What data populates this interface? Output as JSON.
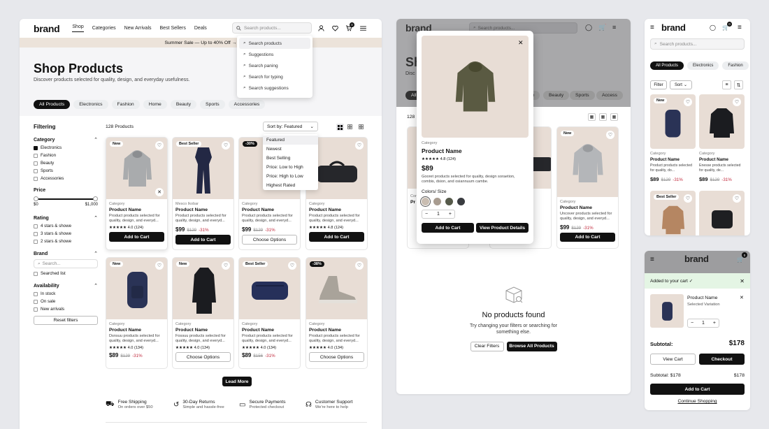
{
  "brand": "brand",
  "nav": [
    "Shop",
    "Categories",
    "New Arrivals",
    "Best Sellers",
    "Deals"
  ],
  "search_placeholder": "Search products...",
  "cart_count": "0",
  "banner": "Summer Sale — Up to 40% Off →",
  "suggestions": [
    "Search products",
    "Suggestions",
    "Search paning",
    "Search for typing",
    "Search suggestions"
  ],
  "hero": {
    "title": "Shop Products",
    "subtitle": "Discover products selected for quality, design, and everyday usefulness."
  },
  "categories": [
    "All Products",
    "Electronics",
    "Fashion",
    "Home",
    "Beauty",
    "Sports",
    "Accessories"
  ],
  "filter": {
    "title": "Filtering",
    "category_label": "Category",
    "category_options": [
      "Electronics",
      "Fashion",
      "Beauty",
      "Sports",
      "Accessories"
    ],
    "price_label": "Price",
    "price_min": "$0",
    "price_max": "$1,000",
    "rating_label": "Rating",
    "rating_options": [
      "4 stars & showe",
      "3 stars & showe",
      "2 stars & showe"
    ],
    "brand_label": "Brand",
    "brand_search": "Search...",
    "brand_option": "Searched list",
    "availability_label": "Availability",
    "availability_options": [
      "In stock",
      "On sale",
      "New arrivals"
    ],
    "reset": "Reset filters"
  },
  "count": "128 Products",
  "sort": {
    "label": "Sort by: Featured",
    "options": [
      "Featured",
      "Newest",
      "Best Selling",
      "Price: Low to High",
      "Price: High to Low",
      "Highest Rated"
    ]
  },
  "products": [
    {
      "badge": "New",
      "cat": "Category",
      "name": "Product Name",
      "desc": "Product products selected for quality, design, and everyd...",
      "rating": "★★★★★ 4.0 (124)",
      "price": "$89",
      "old": "",
      "off": "",
      "btn": "Add to Cart",
      "dark": true
    },
    {
      "badge": "Best Seller",
      "cat": "Mesco Ikobar",
      "name": "Product Name",
      "desc": "Product products selected for quality, design, and everyd...",
      "rating": "",
      "price": "$99",
      "old": "$129",
      "off": "-31%",
      "btn": "Add to Cart",
      "dark": true
    },
    {
      "badge": "-30%",
      "cat": "Category",
      "name": "Product Name",
      "desc": "Product products selected for quality, design, and everyd...",
      "rating": "",
      "price": "$99",
      "old": "$129",
      "off": "-31%",
      "btn": "Choose Options",
      "dark": false
    },
    {
      "badge": "",
      "cat": "Category",
      "name": "Product Name",
      "desc": "Product products selected for quality, design, and everyd...",
      "rating": "★★★★★ 4.8 (124)",
      "price": "$89",
      "old": "$129",
      "off": "-31%",
      "btn": "Add to Cart",
      "dark": true
    },
    {
      "badge": "New",
      "cat": "Category",
      "name": "Product Name",
      "desc": "Dsnsuu products selected for quality, design, and everyd...",
      "rating": "★★★★★ 4.0 (134)",
      "price": "$89",
      "old": "$129",
      "off": "-31%",
      "btn": "",
      "dark": true
    },
    {
      "badge": "New",
      "cat": "Category",
      "name": "Product Name",
      "desc": "Fossuu products selected for quality, design, and everyd...",
      "rating": "★★★★★ 4.0 (134)",
      "price": "",
      "old": "",
      "off": "",
      "btn": "Choose Options",
      "dark": false
    },
    {
      "badge": "Best Seller",
      "cat": "Category",
      "name": "Product Name",
      "desc": "Product products selected for quality, design, and everyd...",
      "rating": "★★★★★ 4.0 (134)",
      "price": "$89",
      "old": "$156",
      "off": "-31%",
      "btn": "",
      "dark": true
    },
    {
      "badge": "-38%",
      "cat": "Category",
      "name": "Product Name",
      "desc": "Product products selected for quality, design, and everyd...",
      "rating": "★★★★★ 4.0 (134)",
      "price": "",
      "old": "",
      "off": "",
      "btn": "Choose Options",
      "dark": false
    }
  ],
  "load_more": "Lead More",
  "features": [
    {
      "title": "Free Shipping",
      "sub": "On orders over $50"
    },
    {
      "title": "30-Day Returns",
      "sub": "Simple and hassle-free"
    },
    {
      "title": "Secure Payments",
      "sub": "Protected checkout"
    },
    {
      "title": "Customer Support",
      "sub": "We're here to help"
    }
  ],
  "modal": {
    "cat": "Category",
    "name": "Product Name",
    "rating": "★★★★★ 4.8 (124)",
    "price": "$89",
    "desc": "Gooret products selected for quality, design soraetion, combis, dsion, and osiannuum cambe.",
    "colors_label": "Colors/ Size",
    "qty": "1",
    "add": "Add to Cart",
    "details": "View Product Details",
    "swatches": [
      "#c9bdb1",
      "#a89c90",
      "#565a4a",
      "#3a3c40"
    ]
  },
  "mid_bg": {
    "letters": "Sh",
    "disc": "Disc",
    "count": "128",
    "chips": [
      "All",
      "me",
      "Beauty",
      "Sports",
      "Access"
    ]
  },
  "mid_cards": [
    {
      "badge": "",
      "cat": "Category",
      "name": "Product Name",
      "desc": "",
      "price": "",
      "btn": "",
      "dark": false
    },
    {
      "badge": "New",
      "cat": "Category",
      "name": "Product Name",
      "desc": "Uncover products selected for quality, design, and everyd...",
      "price": "$99",
      "old": "$129",
      "off": "-31%",
      "btn": "Add to Cart",
      "dark": true
    }
  ],
  "mid_left_labels": [
    "Cor",
    "Pr"
  ],
  "empty": {
    "title": "No products found",
    "sub": "Try changing your filters or searching for something else.",
    "clear": "Clear Filters",
    "browse": "Browse All Products"
  },
  "mobile1": {
    "chips": [
      "All Products",
      "Electronics",
      "Fashion",
      "H"
    ],
    "filter": "Filter",
    "sort": "Sort",
    "products": [
      {
        "badge": "New",
        "cat": "Category",
        "name": "Product Name",
        "desc": "Product products selected for quality, do...",
        "price": "$89",
        "old": "$129",
        "off": "-31%"
      },
      {
        "badge": "",
        "cat": "Category",
        "name": "Product Name",
        "desc": "Enesse products selected for quality, de...",
        "price": "$89",
        "old": "$129",
        "off": "-31%"
      },
      {
        "badge": "Best Seller",
        "cat": "",
        "name": "",
        "desc": "",
        "price": "",
        "old": "",
        "off": ""
      },
      {
        "badge": "",
        "cat": "",
        "name": "",
        "desc": "",
        "price": "",
        "old": "",
        "off": ""
      }
    ]
  },
  "mobile2": {
    "cart_title": "Added to your cart ✓",
    "item_name": "Product Name",
    "item_variant": "Selected Variation",
    "qty": "1",
    "subtotal_label": "Subtotal:",
    "subtotal": "$178",
    "view_cart": "View Cart",
    "checkout": "Checkout",
    "subtotal2_label": "Subtotal: $178",
    "subtotal2": "$178",
    "add": "Add to Cart",
    "continue": "Continue Shopping"
  }
}
